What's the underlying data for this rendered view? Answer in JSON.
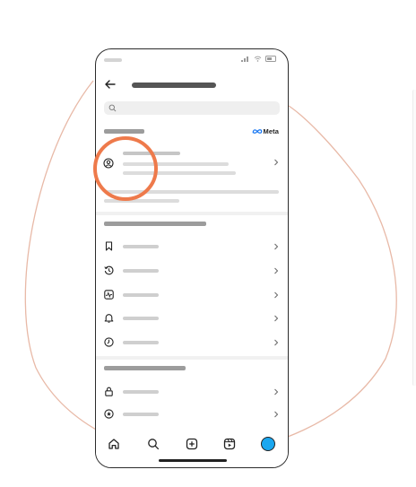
{
  "branding": {
    "meta_text": "Meta"
  },
  "colors": {
    "accent_circle": "#ee7a4b",
    "blob_stroke": "#e8b9a7",
    "avatar": "#1aa7f0"
  },
  "icons": {
    "back": "back-arrow-icon",
    "search": "search-icon",
    "account": "account-circle-icon",
    "list": [
      "bookmark-icon",
      "history-icon",
      "activity-icon",
      "bell-icon",
      "clock-icon",
      "lock-icon",
      "star-circle-icon"
    ],
    "bottom_nav": [
      "home-icon",
      "search-icon",
      "create-icon",
      "reels-icon",
      "profile-avatar"
    ]
  }
}
